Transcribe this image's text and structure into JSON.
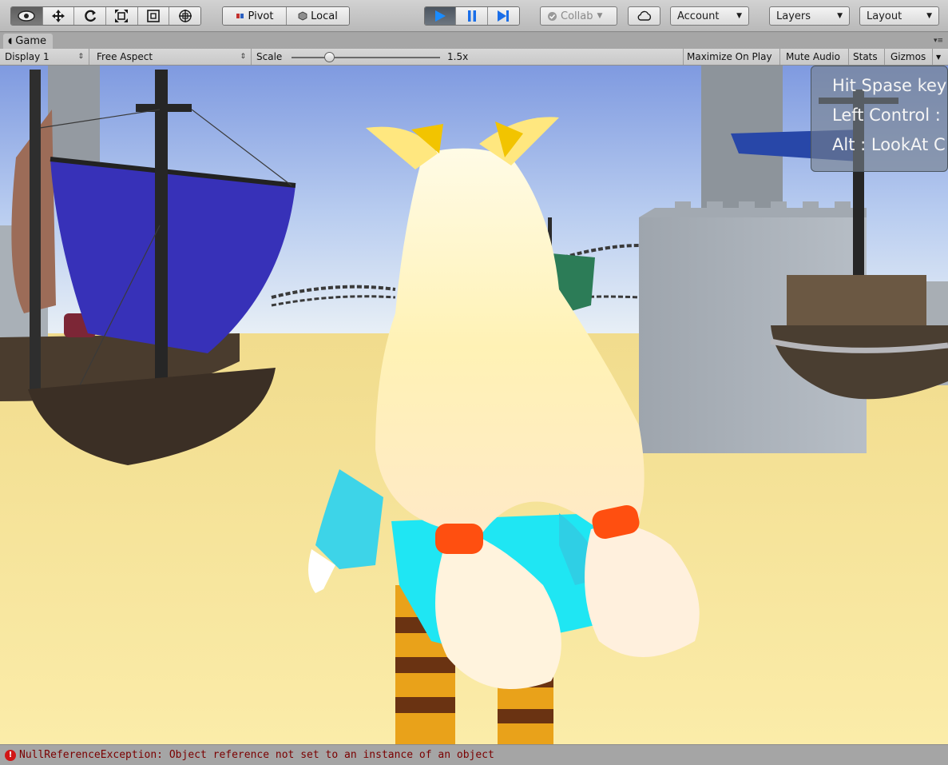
{
  "toolbar": {
    "pivot_label": "Pivot",
    "local_label": "Local",
    "collab_label": "Collab",
    "account_label": "Account",
    "layers_label": "Layers",
    "layout_label": "Layout"
  },
  "game_tab": {
    "title": "Game"
  },
  "game_bar": {
    "display": "Display 1",
    "aspect": "Free Aspect",
    "scale_label": "Scale",
    "scale_value": "1.5x",
    "maximize_on_play": "Maximize On Play",
    "mute_audio": "Mute Audio",
    "stats": "Stats",
    "gizmos": "Gizmos"
  },
  "hint_box": {
    "line1": "Hit Spase key",
    "line2": "Left Control :",
    "line3": "Alt : LookAt C"
  },
  "status": {
    "message": "NullReferenceException: Object reference not set to an instance of an object"
  },
  "colors": {
    "error": "#d11616",
    "play_active": "#1a6ee8"
  }
}
